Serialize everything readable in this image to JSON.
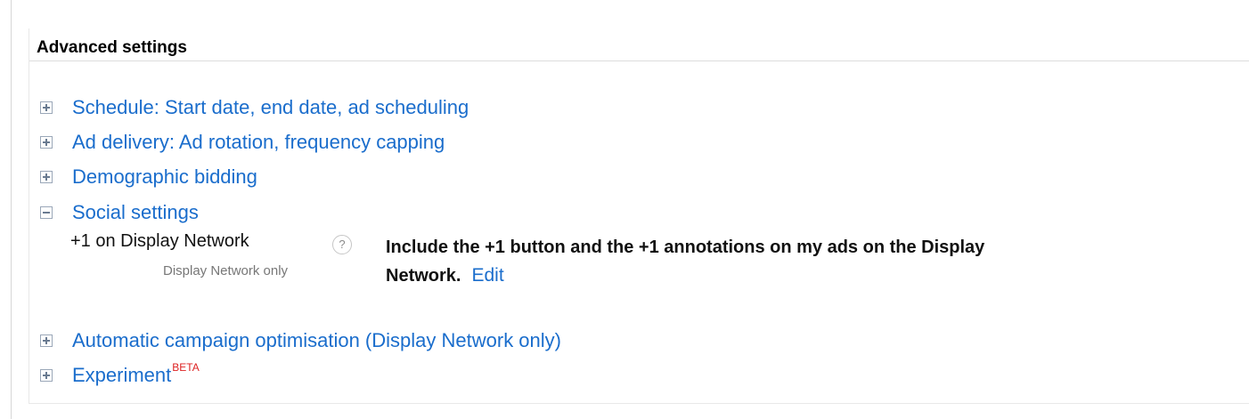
{
  "panel": {
    "title": "Advanced settings"
  },
  "sections": {
    "schedule": {
      "label": "Schedule: Start date, end date, ad scheduling"
    },
    "ad_delivery": {
      "label": "Ad delivery: Ad rotation, frequency capping"
    },
    "demographic": {
      "label": "Demographic bidding"
    },
    "social": {
      "label": "Social settings"
    },
    "automatic": {
      "label": "Automatic campaign optimisation (Display Network only)"
    },
    "experiment": {
      "label": "Experiment",
      "badge": "BETA"
    }
  },
  "social_setting": {
    "name": "+1 on Display Network",
    "help_glyph": "?",
    "subtext": "Display Network only",
    "description_line1": "Include the +1 button and the +1 annotations on my ads on the Display",
    "description_line2": "Network.",
    "edit_label": "Edit"
  },
  "colors": {
    "link": "#1a6dcc",
    "beta": "#dd2222"
  }
}
